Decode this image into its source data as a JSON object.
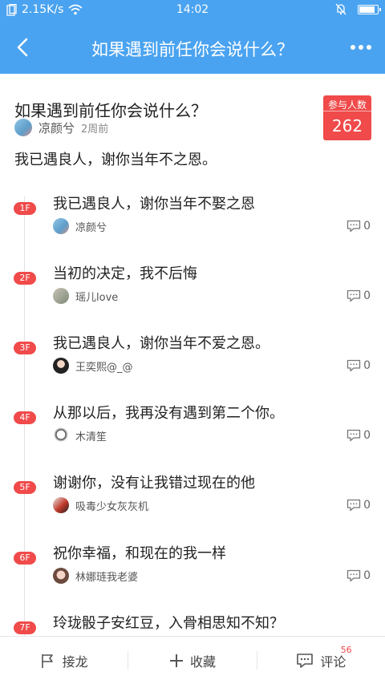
{
  "status": {
    "speed": "2.15K/s",
    "time": "14:02",
    "battery_level": 0.85
  },
  "nav": {
    "title": "如果遇到前任你会说什么？"
  },
  "topic": {
    "question": "如果遇到前任你会说什么？",
    "author": "凉颜兮",
    "time": "2周前",
    "answer": "我已遇良人，谢你当年不之恩。",
    "count_label": "参与人数",
    "count": "262"
  },
  "replies": [
    {
      "floor": "1F",
      "text": "我已遇良人，谢你当年不娶之恩",
      "user": "凉颜兮",
      "comments": "0"
    },
    {
      "floor": "2F",
      "text": "当初的决定，我不后悔",
      "user": "瑶儿love",
      "comments": "0"
    },
    {
      "floor": "3F",
      "text": "我已遇良人，谢你当年不爱之恩。",
      "user": "王奕熙@_@",
      "comments": "0"
    },
    {
      "floor": "4F",
      "text": "从那以后，我再没有遇到第二个你。",
      "user": "木清笙",
      "comments": "0"
    },
    {
      "floor": "5F",
      "text": "谢谢你，没有让我错过现在的他",
      "user": "吸毒少女灰灰机",
      "comments": "0"
    },
    {
      "floor": "6F",
      "text": "祝你幸福，和现在的我一样",
      "user": "林娜琏我老婆",
      "comments": "0"
    },
    {
      "floor": "7F",
      "text": "玲珑骰子安红豆，入骨相思知不知？",
      "user": "",
      "comments": ""
    }
  ],
  "bottom": {
    "relay": "接龙",
    "collect": "收藏",
    "comment": "评论",
    "comment_badge": "56"
  }
}
